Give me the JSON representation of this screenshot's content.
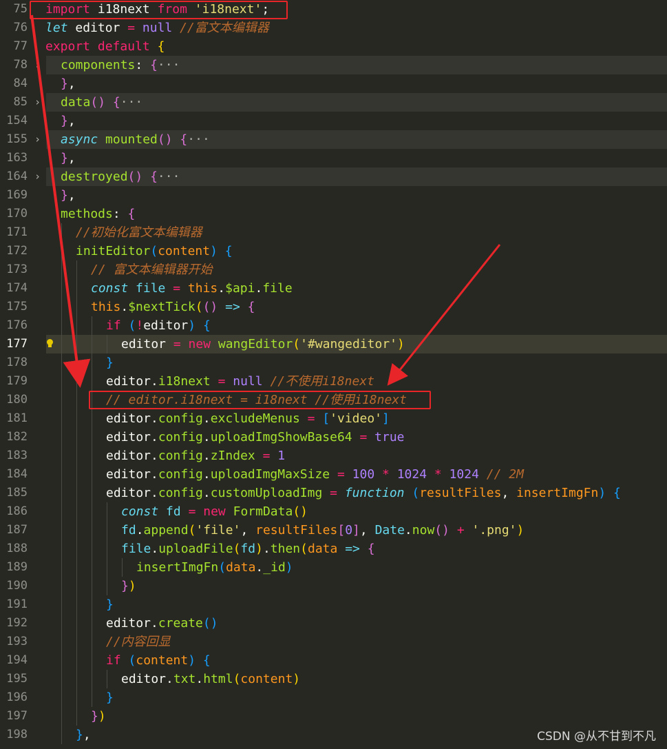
{
  "watermark": "CSDN @从不甘到不凡",
  "colors": {
    "background": "#272822",
    "highlight_box": "#e8262a",
    "arrow": "#e8262a"
  },
  "icons": {
    "fold": "chevron-right-icon",
    "hint": "lightbulb-icon"
  },
  "lines": [
    {
      "n": "75",
      "fold": false,
      "indent": 0,
      "tokens": [
        [
          "kw",
          "import"
        ],
        [
          "pc",
          " i18next "
        ],
        [
          "kw",
          "from"
        ],
        [
          "pc",
          " "
        ],
        [
          "st",
          "'i18next'"
        ],
        [
          "pc",
          ";"
        ]
      ]
    },
    {
      "n": "76",
      "fold": false,
      "indent": 0,
      "tokens": [
        [
          "k2",
          "let"
        ],
        [
          "pc",
          " editor "
        ],
        [
          "ops",
          "="
        ],
        [
          "pc",
          " "
        ],
        [
          "nu",
          "null"
        ],
        [
          "pc",
          " "
        ],
        [
          "cm",
          "//富文本编辑器"
        ]
      ]
    },
    {
      "n": "77",
      "fold": false,
      "indent": 0,
      "tokens": [
        [
          "kw",
          "export"
        ],
        [
          "pc",
          " "
        ],
        [
          "kw",
          "default"
        ],
        [
          "pc",
          " "
        ],
        [
          "b1",
          "{"
        ]
      ]
    },
    {
      "n": "78",
      "fold": true,
      "indent": 1,
      "tokens": [
        [
          "fn",
          "components"
        ],
        [
          "pc",
          ": "
        ],
        [
          "b2",
          "{"
        ],
        [
          "fold-ellipsis",
          "···"
        ]
      ]
    },
    {
      "n": "84",
      "fold": false,
      "indent": 1,
      "tokens": [
        [
          "b2",
          "}"
        ],
        [
          "pc",
          ","
        ]
      ]
    },
    {
      "n": "85",
      "fold": true,
      "indent": 1,
      "tokens": [
        [
          "fn",
          "data"
        ],
        [
          "b2",
          "()"
        ],
        [
          "pc",
          " "
        ],
        [
          "b2",
          "{"
        ],
        [
          "fold-ellipsis",
          "···"
        ]
      ]
    },
    {
      "n": "154",
      "fold": false,
      "indent": 1,
      "tokens": [
        [
          "b2",
          "}"
        ],
        [
          "pc",
          ","
        ]
      ]
    },
    {
      "n": "155",
      "fold": true,
      "indent": 1,
      "tokens": [
        [
          "k2",
          "async"
        ],
        [
          "pc",
          " "
        ],
        [
          "fn",
          "mounted"
        ],
        [
          "b2",
          "()"
        ],
        [
          "pc",
          " "
        ],
        [
          "b2",
          "{"
        ],
        [
          "fold-ellipsis",
          "···"
        ]
      ]
    },
    {
      "n": "163",
      "fold": false,
      "indent": 1,
      "tokens": [
        [
          "b2",
          "}"
        ],
        [
          "pc",
          ","
        ]
      ]
    },
    {
      "n": "164",
      "fold": true,
      "indent": 1,
      "tokens": [
        [
          "fn",
          "destroyed"
        ],
        [
          "b2",
          "()"
        ],
        [
          "pc",
          " "
        ],
        [
          "b2",
          "{"
        ],
        [
          "fold-ellipsis",
          "···"
        ]
      ]
    },
    {
      "n": "169",
      "fold": false,
      "indent": 1,
      "tokens": [
        [
          "b2",
          "}"
        ],
        [
          "pc",
          ","
        ]
      ]
    },
    {
      "n": "170",
      "fold": false,
      "indent": 1,
      "tokens": [
        [
          "fn",
          "methods"
        ],
        [
          "pc",
          ": "
        ],
        [
          "b2",
          "{"
        ]
      ]
    },
    {
      "n": "171",
      "fold": false,
      "indent": 2,
      "tokens": [
        [
          "cm",
          "//初始化富文本编辑器"
        ]
      ]
    },
    {
      "n": "172",
      "fold": false,
      "indent": 2,
      "tokens": [
        [
          "fn",
          "initEditor"
        ],
        [
          "b3",
          "("
        ],
        [
          "pa",
          "content"
        ],
        [
          "b3",
          ")"
        ],
        [
          "pc",
          " "
        ],
        [
          "b3",
          "{"
        ]
      ]
    },
    {
      "n": "173",
      "fold": false,
      "indent": 3,
      "tokens": [
        [
          "cm",
          "// 富文本编辑器开始"
        ]
      ]
    },
    {
      "n": "174",
      "fold": false,
      "indent": 3,
      "tokens": [
        [
          "k2",
          "const"
        ],
        [
          "pc",
          " "
        ],
        [
          "k3",
          "file"
        ],
        [
          "pc",
          " "
        ],
        [
          "ops",
          "="
        ],
        [
          "pc",
          " "
        ],
        [
          "th",
          "this"
        ],
        [
          "pc",
          "."
        ],
        [
          "pr",
          "$api"
        ],
        [
          "pc",
          "."
        ],
        [
          "pr",
          "file"
        ]
      ]
    },
    {
      "n": "175",
      "fold": false,
      "indent": 3,
      "tokens": [
        [
          "th",
          "this"
        ],
        [
          "pc",
          "."
        ],
        [
          "fn",
          "$nextTick"
        ],
        [
          "b1",
          "("
        ],
        [
          "b2",
          "()"
        ],
        [
          "pc",
          " "
        ],
        [
          "k3",
          "=>"
        ],
        [
          "pc",
          " "
        ],
        [
          "b2",
          "{"
        ]
      ]
    },
    {
      "n": "176",
      "fold": false,
      "indent": 4,
      "tokens": [
        [
          "kw",
          "if"
        ],
        [
          "pc",
          " "
        ],
        [
          "b3",
          "("
        ],
        [
          "ops",
          "!"
        ],
        [
          "pc",
          "editor"
        ],
        [
          "b3",
          ")"
        ],
        [
          "pc",
          " "
        ],
        [
          "b3",
          "{"
        ]
      ]
    },
    {
      "n": "177",
      "fold": false,
      "indent": 5,
      "current": true,
      "tokens": [
        [
          "pc",
          "editor "
        ],
        [
          "ops",
          "="
        ],
        [
          "pc",
          " "
        ],
        [
          "kw",
          "new"
        ],
        [
          "pc",
          " "
        ],
        [
          "fn",
          "wangEditor"
        ],
        [
          "b1",
          "("
        ],
        [
          "st",
          "'#wangeditor'"
        ],
        [
          "b1",
          ")"
        ]
      ]
    },
    {
      "n": "178",
      "fold": false,
      "indent": 4,
      "tokens": [
        [
          "b3",
          "}"
        ]
      ]
    },
    {
      "n": "179",
      "fold": false,
      "indent": 4,
      "tokens": [
        [
          "pc",
          "editor."
        ],
        [
          "pr",
          "i18next"
        ],
        [
          "pc",
          " "
        ],
        [
          "ops",
          "="
        ],
        [
          "pc",
          " "
        ],
        [
          "nu",
          "null"
        ],
        [
          "pc",
          " "
        ],
        [
          "cm",
          "//不使用i18next"
        ]
      ]
    },
    {
      "n": "180",
      "fold": false,
      "indent": 4,
      "tokens": [
        [
          "cm",
          "// editor.i18next = i18next //使用i18next"
        ]
      ]
    },
    {
      "n": "181",
      "fold": false,
      "indent": 4,
      "tokens": [
        [
          "pc",
          "editor."
        ],
        [
          "pr",
          "config"
        ],
        [
          "pc",
          "."
        ],
        [
          "pr",
          "excludeMenus"
        ],
        [
          "pc",
          " "
        ],
        [
          "ops",
          "="
        ],
        [
          "pc",
          " "
        ],
        [
          "b3",
          "["
        ],
        [
          "st",
          "'video'"
        ],
        [
          "b3",
          "]"
        ]
      ]
    },
    {
      "n": "182",
      "fold": false,
      "indent": 4,
      "tokens": [
        [
          "pc",
          "editor."
        ],
        [
          "pr",
          "config"
        ],
        [
          "pc",
          "."
        ],
        [
          "pr",
          "uploadImgShowBase64"
        ],
        [
          "pc",
          " "
        ],
        [
          "ops",
          "="
        ],
        [
          "pc",
          " "
        ],
        [
          "nu",
          "true"
        ]
      ]
    },
    {
      "n": "183",
      "fold": false,
      "indent": 4,
      "tokens": [
        [
          "pc",
          "editor."
        ],
        [
          "pr",
          "config"
        ],
        [
          "pc",
          "."
        ],
        [
          "pr",
          "zIndex"
        ],
        [
          "pc",
          " "
        ],
        [
          "ops",
          "="
        ],
        [
          "pc",
          " "
        ],
        [
          "nu",
          "1"
        ]
      ]
    },
    {
      "n": "184",
      "fold": false,
      "indent": 4,
      "tokens": [
        [
          "pc",
          "editor."
        ],
        [
          "pr",
          "config"
        ],
        [
          "pc",
          "."
        ],
        [
          "pr",
          "uploadImgMaxSize"
        ],
        [
          "pc",
          " "
        ],
        [
          "ops",
          "="
        ],
        [
          "pc",
          " "
        ],
        [
          "nu",
          "100"
        ],
        [
          "pc",
          " "
        ],
        [
          "ops",
          "*"
        ],
        [
          "pc",
          " "
        ],
        [
          "nu",
          "1024"
        ],
        [
          "pc",
          " "
        ],
        [
          "ops",
          "*"
        ],
        [
          "pc",
          " "
        ],
        [
          "nu",
          "1024"
        ],
        [
          "pc",
          " "
        ],
        [
          "cm",
          "// 2M"
        ]
      ]
    },
    {
      "n": "185",
      "fold": false,
      "indent": 4,
      "tokens": [
        [
          "pc",
          "editor."
        ],
        [
          "pr",
          "config"
        ],
        [
          "pc",
          "."
        ],
        [
          "fn",
          "customUploadImg"
        ],
        [
          "pc",
          " "
        ],
        [
          "ops",
          "="
        ],
        [
          "pc",
          " "
        ],
        [
          "k2",
          "function"
        ],
        [
          "pc",
          " "
        ],
        [
          "b3",
          "("
        ],
        [
          "pa",
          "resultFiles"
        ],
        [
          "pc",
          ", "
        ],
        [
          "pa",
          "insertImgFn"
        ],
        [
          "b3",
          ")"
        ],
        [
          "pc",
          " "
        ],
        [
          "b3",
          "{"
        ]
      ]
    },
    {
      "n": "186",
      "fold": false,
      "indent": 5,
      "tokens": [
        [
          "k2",
          "const"
        ],
        [
          "pc",
          " "
        ],
        [
          "k3",
          "fd"
        ],
        [
          "pc",
          " "
        ],
        [
          "ops",
          "="
        ],
        [
          "pc",
          " "
        ],
        [
          "kw",
          "new"
        ],
        [
          "pc",
          " "
        ],
        [
          "fn",
          "FormData"
        ],
        [
          "b1",
          "()"
        ]
      ]
    },
    {
      "n": "187",
      "fold": false,
      "indent": 5,
      "tokens": [
        [
          "k3",
          "fd"
        ],
        [
          "pc",
          "."
        ],
        [
          "fn",
          "append"
        ],
        [
          "b1",
          "("
        ],
        [
          "st",
          "'file'"
        ],
        [
          "pc",
          ", "
        ],
        [
          "pa",
          "resultFiles"
        ],
        [
          "b2",
          "["
        ],
        [
          "nu",
          "0"
        ],
        [
          "b2",
          "]"
        ],
        [
          "pc",
          ", "
        ],
        [
          "k3",
          "Date"
        ],
        [
          "pc",
          "."
        ],
        [
          "fn",
          "now"
        ],
        [
          "b2",
          "()"
        ],
        [
          "pc",
          " "
        ],
        [
          "ops",
          "+"
        ],
        [
          "pc",
          " "
        ],
        [
          "st",
          "'.png'"
        ],
        [
          "b1",
          ")"
        ]
      ]
    },
    {
      "n": "188",
      "fold": false,
      "indent": 5,
      "tokens": [
        [
          "k3",
          "file"
        ],
        [
          "pc",
          "."
        ],
        [
          "fn",
          "uploadFile"
        ],
        [
          "b1",
          "("
        ],
        [
          "k3",
          "fd"
        ],
        [
          "b1",
          ")"
        ],
        [
          "pc",
          "."
        ],
        [
          "fn",
          "then"
        ],
        [
          "b1",
          "("
        ],
        [
          "pa",
          "data"
        ],
        [
          "pc",
          " "
        ],
        [
          "k3",
          "=>"
        ],
        [
          "pc",
          " "
        ],
        [
          "b2",
          "{"
        ]
      ]
    },
    {
      "n": "189",
      "fold": false,
      "indent": 6,
      "tokens": [
        [
          "fn",
          "insertImgFn"
        ],
        [
          "b3",
          "("
        ],
        [
          "pa",
          "data"
        ],
        [
          "pc",
          "."
        ],
        [
          "pr",
          "_id"
        ],
        [
          "b3",
          ")"
        ]
      ]
    },
    {
      "n": "190",
      "fold": false,
      "indent": 5,
      "tokens": [
        [
          "b2",
          "}"
        ],
        [
          "b1",
          ")"
        ]
      ]
    },
    {
      "n": "191",
      "fold": false,
      "indent": 4,
      "tokens": [
        [
          "b3",
          "}"
        ]
      ]
    },
    {
      "n": "192",
      "fold": false,
      "indent": 4,
      "tokens": [
        [
          "pc",
          "editor."
        ],
        [
          "fn",
          "create"
        ],
        [
          "b3",
          "()"
        ]
      ]
    },
    {
      "n": "193",
      "fold": false,
      "indent": 4,
      "tokens": [
        [
          "cm",
          "//内容回显"
        ]
      ]
    },
    {
      "n": "194",
      "fold": false,
      "indent": 4,
      "tokens": [
        [
          "kw",
          "if"
        ],
        [
          "pc",
          " "
        ],
        [
          "b3",
          "("
        ],
        [
          "pa",
          "content"
        ],
        [
          "b3",
          ")"
        ],
        [
          "pc",
          " "
        ],
        [
          "b3",
          "{"
        ]
      ]
    },
    {
      "n": "195",
      "fold": false,
      "indent": 5,
      "tokens": [
        [
          "pc",
          "editor."
        ],
        [
          "pr",
          "txt"
        ],
        [
          "pc",
          "."
        ],
        [
          "fn",
          "html"
        ],
        [
          "b1",
          "("
        ],
        [
          "pa",
          "content"
        ],
        [
          "b1",
          ")"
        ]
      ]
    },
    {
      "n": "196",
      "fold": false,
      "indent": 4,
      "tokens": [
        [
          "b3",
          "}"
        ]
      ]
    },
    {
      "n": "197",
      "fold": false,
      "indent": 3,
      "tokens": [
        [
          "b2",
          "}"
        ],
        [
          "b1",
          ")"
        ]
      ]
    },
    {
      "n": "198",
      "fold": false,
      "indent": 2,
      "tokens": [
        [
          "b3",
          "}"
        ],
        [
          "pc",
          ","
        ]
      ]
    }
  ]
}
